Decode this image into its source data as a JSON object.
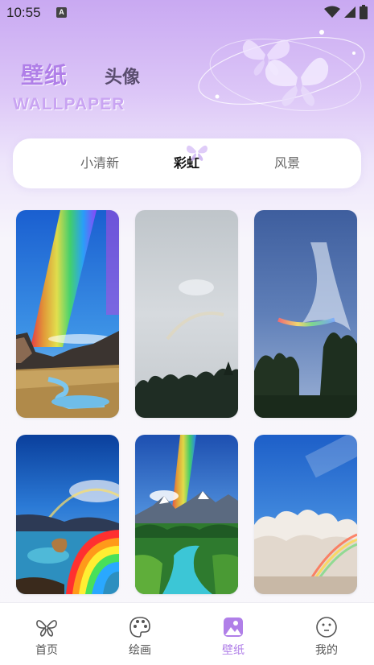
{
  "status_bar": {
    "time": "10:55",
    "notification_icon": "A"
  },
  "header": {
    "title_active": "壁纸",
    "title_inactive": "头像",
    "title_en": "WALLPAPER"
  },
  "tabs": [
    {
      "label": "小清新",
      "active": false
    },
    {
      "label": "彩虹",
      "active": true
    },
    {
      "label": "风景",
      "active": false
    }
  ],
  "wallpapers": [
    {
      "scene": "rainbow-over-canyon"
    },
    {
      "scene": "faint-rainbow-in-grey-sky"
    },
    {
      "scene": "rainbow-cloud-above-trees"
    },
    {
      "scene": "double-rainbow-over-lake"
    },
    {
      "scene": "rainbow-over-mountain-river"
    },
    {
      "scene": "rainbow-over-clouds"
    }
  ],
  "bottom_nav": [
    {
      "label": "首页",
      "icon": "butterfly-icon",
      "active": false
    },
    {
      "label": "绘画",
      "icon": "palette-icon",
      "active": false
    },
    {
      "label": "壁纸",
      "icon": "wallpaper-icon",
      "active": true
    },
    {
      "label": "我的",
      "icon": "smiley-icon",
      "active": false
    }
  ],
  "colors": {
    "accent": "#b07fe8",
    "header_gradient_top": "#c9a9f2",
    "background": "#f8f7fb"
  }
}
